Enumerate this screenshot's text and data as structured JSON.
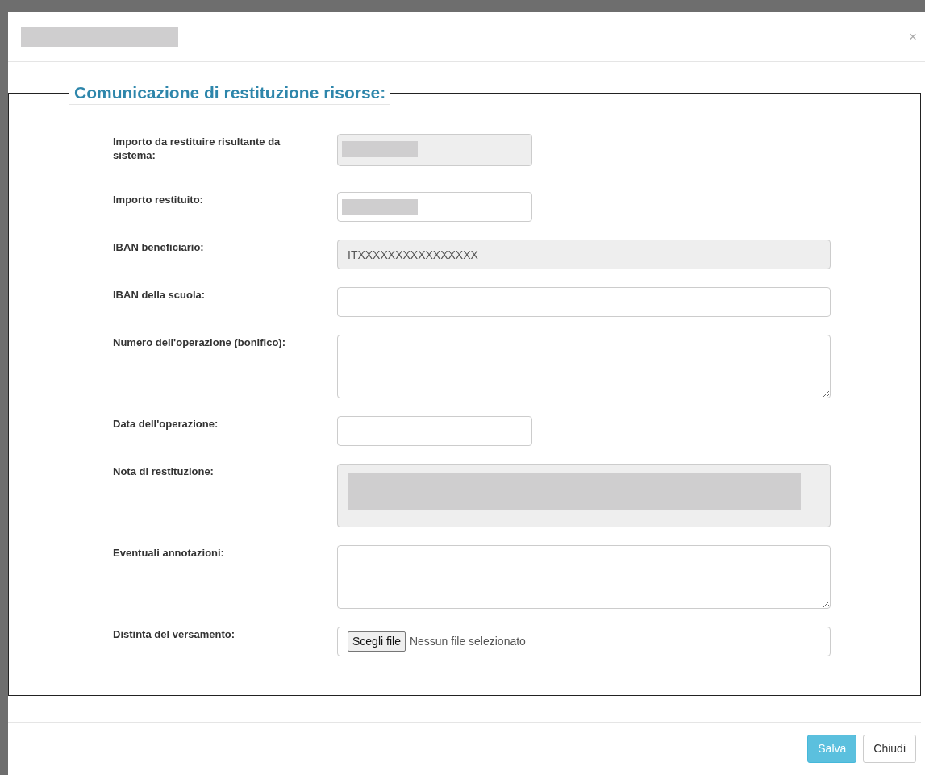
{
  "dialog": {
    "title_redacted": true,
    "close": "×"
  },
  "legend": "Comunicazione di restituzione risorse:",
  "fields": [
    {
      "label": "Importo da restituire risultante da sistema:",
      "kind": "shortinput",
      "disabled": true,
      "redacted": true
    },
    {
      "label": "Importo restituito:",
      "kind": "shortinput",
      "disabled": false,
      "redacted": true
    },
    {
      "label": "IBAN beneficiario:",
      "kind": "input",
      "disabled": true,
      "value": "ITXXXXXXXXXXXXXXXX"
    },
    {
      "label": "IBAN della scuola:",
      "kind": "input",
      "disabled": false
    },
    {
      "label": "Numero dell'operazione (bonifico):",
      "kind": "textarea",
      "disabled": false
    },
    {
      "label": "Data dell'operazione:",
      "kind": "shortinput",
      "disabled": false
    },
    {
      "label": "Nota di restituzione:",
      "kind": "textarea",
      "disabled": true,
      "redacted": true
    },
    {
      "label": "Eventuali annotazioni:",
      "kind": "textarea",
      "disabled": false
    },
    {
      "label": "Distinta del versamento:",
      "kind": "file",
      "button": "Scegli file",
      "status": "Nessun file selezionato"
    }
  ],
  "buttons": [
    {
      "label": "Salva",
      "kind": "primary"
    },
    {
      "label": "Chiudi",
      "kind": "secondary"
    }
  ]
}
